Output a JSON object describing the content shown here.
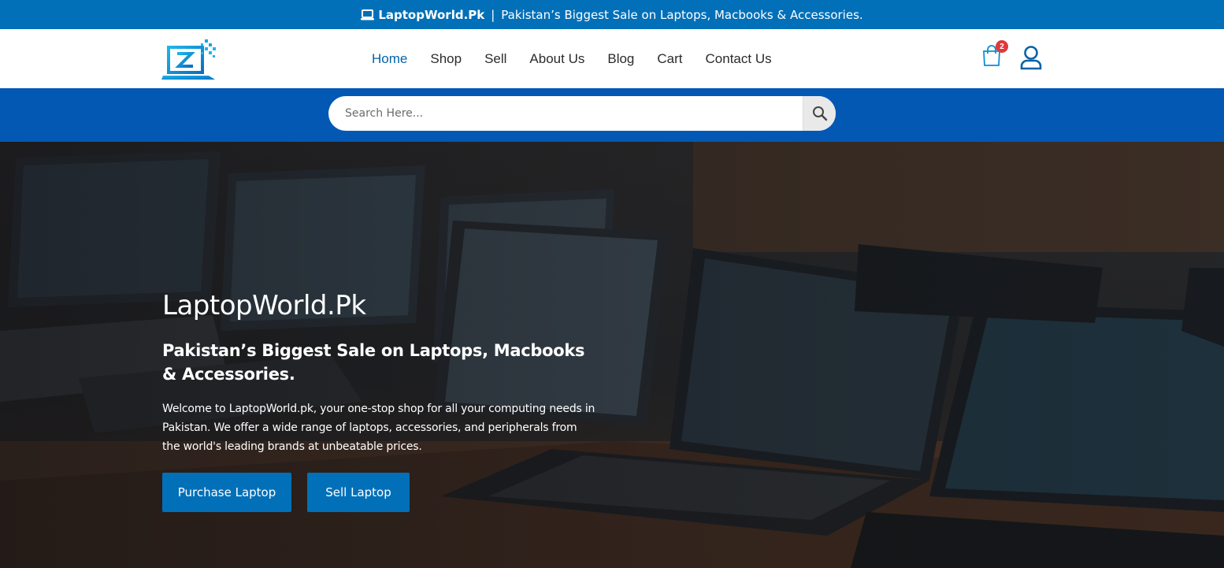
{
  "topbar": {
    "brand": "LaptopWorld.Pk",
    "separator": "|",
    "message": "Pakistan’s Biggest Sale on Laptops, Macbooks & Accessories."
  },
  "nav": {
    "items": [
      {
        "label": "Home"
      },
      {
        "label": "Shop"
      },
      {
        "label": "Sell"
      },
      {
        "label": "About Us"
      },
      {
        "label": "Blog"
      },
      {
        "label": "Cart"
      },
      {
        "label": "Contact Us"
      }
    ],
    "active": "Home"
  },
  "cart": {
    "count": "2"
  },
  "search": {
    "placeholder": "Search Here..."
  },
  "hero": {
    "title": "LaptopWorld.Pk",
    "subtitle": "Pakistan’s Biggest Sale on Laptops, Macbooks & Accessories.",
    "description": "Welcome to LaptopWorld.pk, your one-stop shop for all your computing needs in Pakistan. We offer a wide range of laptops, accessories, and peripherals from the world's leading brands at unbeatable prices.",
    "buttons": {
      "purchase": "Purchase Laptop",
      "sell": "Sell Laptop"
    }
  },
  "colors": {
    "topbar": "#0270b8",
    "search_band": "#0358b4",
    "nav_active": "#0563a8",
    "button": "#0270b8",
    "badge": "#e0383a"
  },
  "icons": {
    "topbar_brand": "laptop-icon",
    "logo": "laptop-logo-icon",
    "cart": "shopping-bag-icon",
    "account": "user-icon",
    "search": "search-icon"
  }
}
